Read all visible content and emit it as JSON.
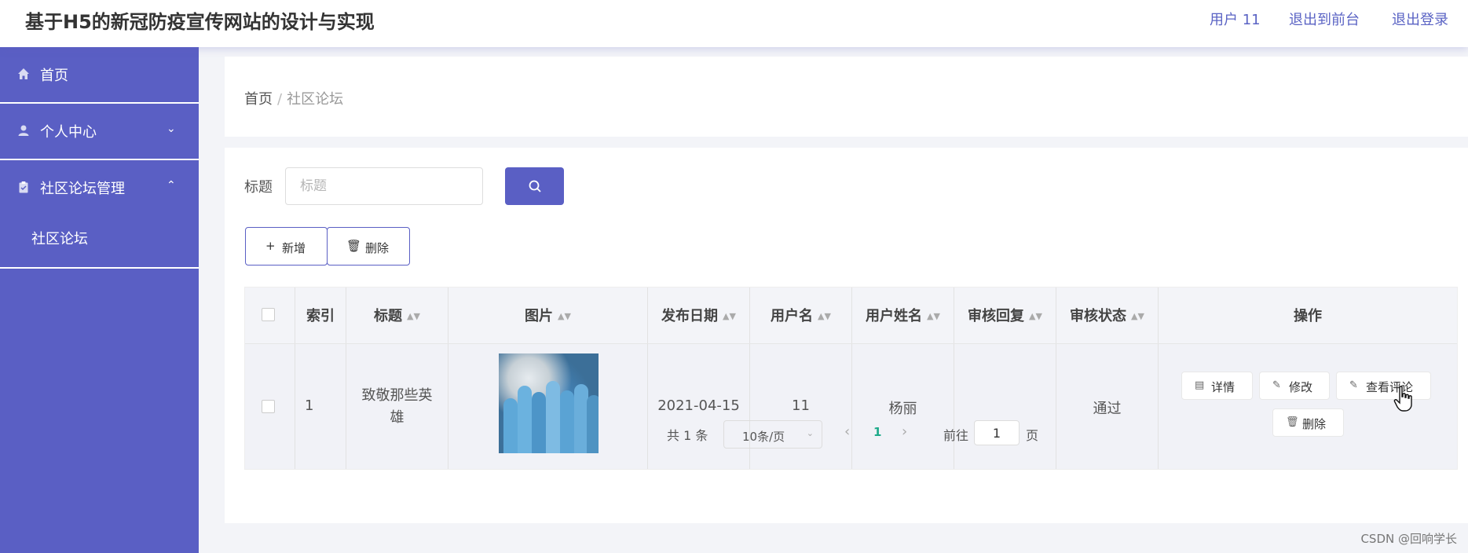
{
  "header": {
    "title": "基于H5的新冠防疫宣传网站的设计与实现",
    "user": "用户 11",
    "to_front": "退出到前台",
    "logout": "退出登录"
  },
  "sidebar": {
    "items": [
      {
        "label": "首页",
        "icon": "home-icon"
      },
      {
        "label": "个人中心",
        "icon": "user-icon",
        "chevron": "⌄"
      },
      {
        "label": "社区论坛管理",
        "icon": "clipboard-icon",
        "chevron": "⌃",
        "children": [
          {
            "label": "社区论坛"
          }
        ]
      }
    ]
  },
  "breadcrumb": {
    "home": "首页",
    "sep": "/",
    "current": "社区论坛"
  },
  "search": {
    "label": "标题",
    "placeholder": "标题"
  },
  "actions": {
    "add": "新增",
    "add_icon": "+",
    "delete": "删除",
    "delete_icon": "🗑"
  },
  "table": {
    "headers": {
      "index": "索引",
      "title": "标题",
      "image": "图片",
      "date": "发布日期",
      "username": "用户名",
      "realname": "用户姓名",
      "reply": "审核回复",
      "status": "审核状态",
      "ops": "操作"
    },
    "rows": [
      {
        "index": "1",
        "title": "致敬那些英雄",
        "date": "2021-04-15",
        "username": "11",
        "realname": "杨丽",
        "reply": "",
        "status": "通过",
        "ops": {
          "detail": "详情",
          "edit": "修改",
          "comments": "查看评论",
          "delete": "删除"
        }
      }
    ]
  },
  "pagination": {
    "total": "共 1 条",
    "page_size": "10条/页",
    "current": "1",
    "goto_label": "前往",
    "goto_value": "1",
    "page_suffix": "页"
  },
  "watermark": "CSDN @回响学长",
  "colors": {
    "primary": "#5a5fc4",
    "page_active": "#1eaa8a"
  }
}
